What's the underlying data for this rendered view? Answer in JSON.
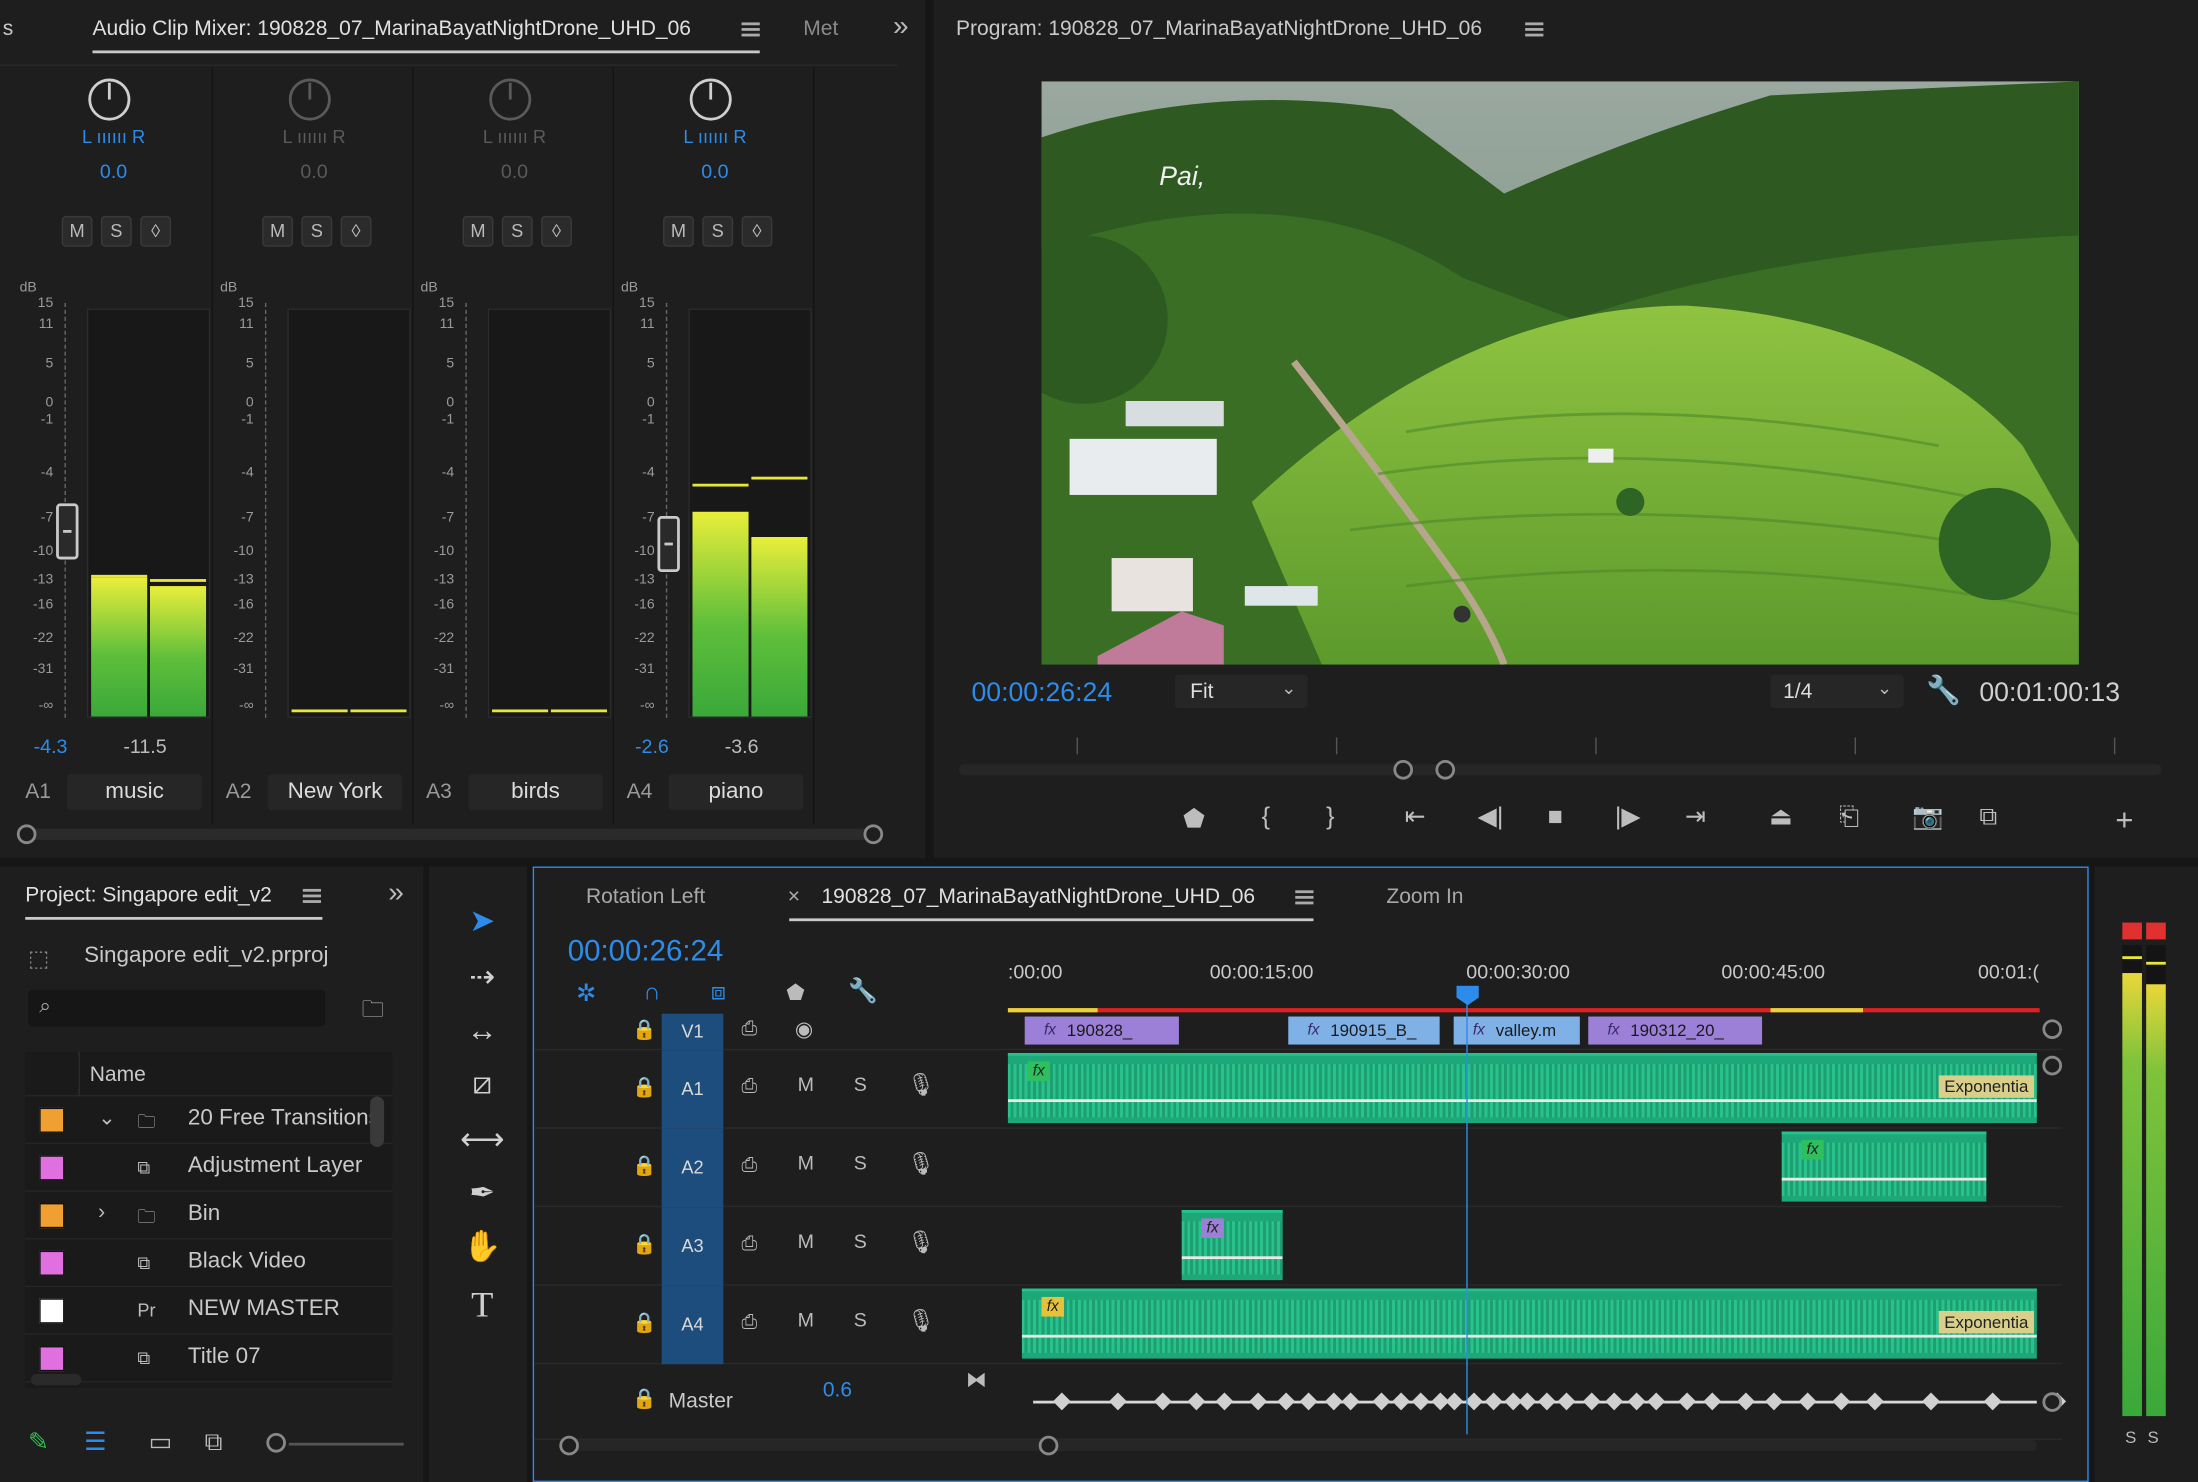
{
  "mixer": {
    "title": "Audio Clip Mixer: 190828_07_MarinaBayatNightDrone_UHD_06",
    "next_tab": "Met",
    "left_edge": "s",
    "db_label": "dB",
    "db_ticks": [
      "15",
      "11",
      "5",
      "0",
      "-1",
      "-4",
      "-7",
      "-10",
      "-13",
      "-16",
      "-22",
      "-31",
      "-∞"
    ],
    "channels": [
      {
        "id": "A1",
        "name": "music",
        "pan": "0.0",
        "lr": "L ıııııı R",
        "m": "M",
        "s": "S",
        "r": "◊",
        "left": "-4.3",
        "right": "-11.5",
        "level_l": 0.34,
        "level_r": 0.32,
        "peak_l": 0.34,
        "peak_r": 0.33,
        "fader": 0.56,
        "active": true
      },
      {
        "id": "A2",
        "name": "New York",
        "pan": "0.0",
        "lr": "L ıııııı R",
        "m": "M",
        "s": "S",
        "r": "◊",
        "left": "",
        "right": "",
        "level_l": 0,
        "level_r": 0,
        "peak_l": 0.01,
        "peak_r": 0.01,
        "fader": -1,
        "active": false
      },
      {
        "id": "A3",
        "name": "birds",
        "pan": "0.0",
        "lr": "L ıııııı R",
        "m": "M",
        "s": "S",
        "r": "◊",
        "left": "",
        "right": "",
        "level_l": 0,
        "level_r": 0,
        "peak_l": 0.01,
        "peak_r": 0.01,
        "fader": -1,
        "active": false
      },
      {
        "id": "A4",
        "name": "piano",
        "pan": "0.0",
        "lr": "L ıııııı R",
        "m": "M",
        "s": "S",
        "r": "◊",
        "left": "-2.6",
        "right": "-3.6",
        "level_l": 0.5,
        "level_r": 0.44,
        "peak_l": 0.56,
        "peak_r": 0.58,
        "fader": 0.62,
        "active": true
      }
    ]
  },
  "program": {
    "title": "Program: 190828_07_MarinaBayatNightDrone_UHD_06",
    "overlay_text": "Pai,",
    "timecode": "00:00:26:24",
    "fit": "Fit",
    "quality": "1/4",
    "duration": "00:01:00:13"
  },
  "project": {
    "title": "Project: Singapore edit_v2",
    "file": "Singapore edit_v2.prproj",
    "search_placeholder": "",
    "col_name": "Name",
    "items": [
      {
        "name": "20 Free Transitions",
        "color": "#f0a030",
        "icon": "folder-icon",
        "expand": "⌄"
      },
      {
        "name": "Adjustment Layer",
        "color": "#e070e0",
        "icon": "adjustment-layer-icon",
        "expand": ""
      },
      {
        "name": "Bin",
        "color": "#f0a030",
        "icon": "folder-icon",
        "expand": "›"
      },
      {
        "name": "Black Video",
        "color": "#e070e0",
        "icon": "black-video-icon",
        "expand": ""
      },
      {
        "name": "NEW MASTER",
        "color": "#ffffff",
        "icon": "sequence-icon",
        "expand": ""
      },
      {
        "name": "Title 07",
        "color": "#e070e0",
        "icon": "title-icon",
        "expand": ""
      }
    ]
  },
  "timeline": {
    "tab_left": "Rotation Left",
    "tab_active": "190828_07_MarinaBayatNightDrone_UHD_06",
    "tab_right": "Zoom In",
    "close": "×",
    "timecode": "00:00:26:24",
    "ruler": [
      ":00:00",
      "00:00:15:00",
      "00:00:30:00",
      "00:00:45:00",
      "00:01:("
    ],
    "master_label": "Master",
    "master_value": "0.6",
    "tracks": [
      {
        "id": "V1"
      },
      {
        "id": "A1",
        "m": "M",
        "s": "S"
      },
      {
        "id": "A2",
        "m": "M",
        "s": "S"
      },
      {
        "id": "A3",
        "m": "M",
        "s": "S"
      },
      {
        "id": "A4",
        "m": "M",
        "s": "S"
      }
    ],
    "video_clips": [
      "190828_",
      "190915_B_",
      "valley.m",
      "190312_20_"
    ],
    "fx_label": "fx",
    "expo_label": "Exponentia"
  },
  "meter": {
    "s_left": "S",
    "s_right": "S"
  }
}
